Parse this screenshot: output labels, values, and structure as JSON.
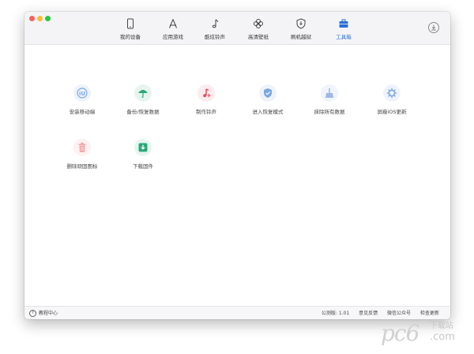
{
  "toolbar": {
    "tabs": [
      {
        "label": "我的设备",
        "icon": "phone-icon",
        "active": false
      },
      {
        "label": "应用游戏",
        "icon": "app-store-icon",
        "active": false
      },
      {
        "label": "酷炫铃声",
        "icon": "music-note-icon",
        "active": false
      },
      {
        "label": "高清壁纸",
        "icon": "clover-icon",
        "active": false
      },
      {
        "label": "刷机越狱",
        "icon": "shield-icon",
        "active": false
      },
      {
        "label": "工具箱",
        "icon": "toolbox-icon",
        "active": true
      }
    ],
    "accent": "#2b6fd6"
  },
  "tools": [
    {
      "label": "安装移动端",
      "icon": "install-mobile-icon",
      "color": "#7aa7e0"
    },
    {
      "label": "备份/恢复数据",
      "icon": "umbrella-icon",
      "color": "#2aa77a"
    },
    {
      "label": "制作铃声",
      "icon": "music-icon",
      "color": "#e84a5f"
    },
    {
      "label": "进入恢复模式",
      "icon": "shield-check-icon",
      "color": "#7aa7e0"
    },
    {
      "label": "抹除所有数据",
      "icon": "broom-icon",
      "color": "#9db8e6"
    },
    {
      "label": "屏蔽iOS更新",
      "icon": "gear-icon",
      "color": "#8fb1e3"
    },
    {
      "label": "删除顽固图标",
      "icon": "trash-icon",
      "color": "#f0a3a3"
    },
    {
      "label": "下载固件",
      "icon": "download-icon",
      "color": "#2aa77a"
    }
  ],
  "status": {
    "help": "教程中心",
    "version": "公测版: 1.01",
    "feedback": "意见反馈",
    "wechat": "微信公众号",
    "update": "检查更新"
  },
  "watermark": {
    "brand": "pc6",
    "cn": "下载站",
    "com": ".com"
  }
}
